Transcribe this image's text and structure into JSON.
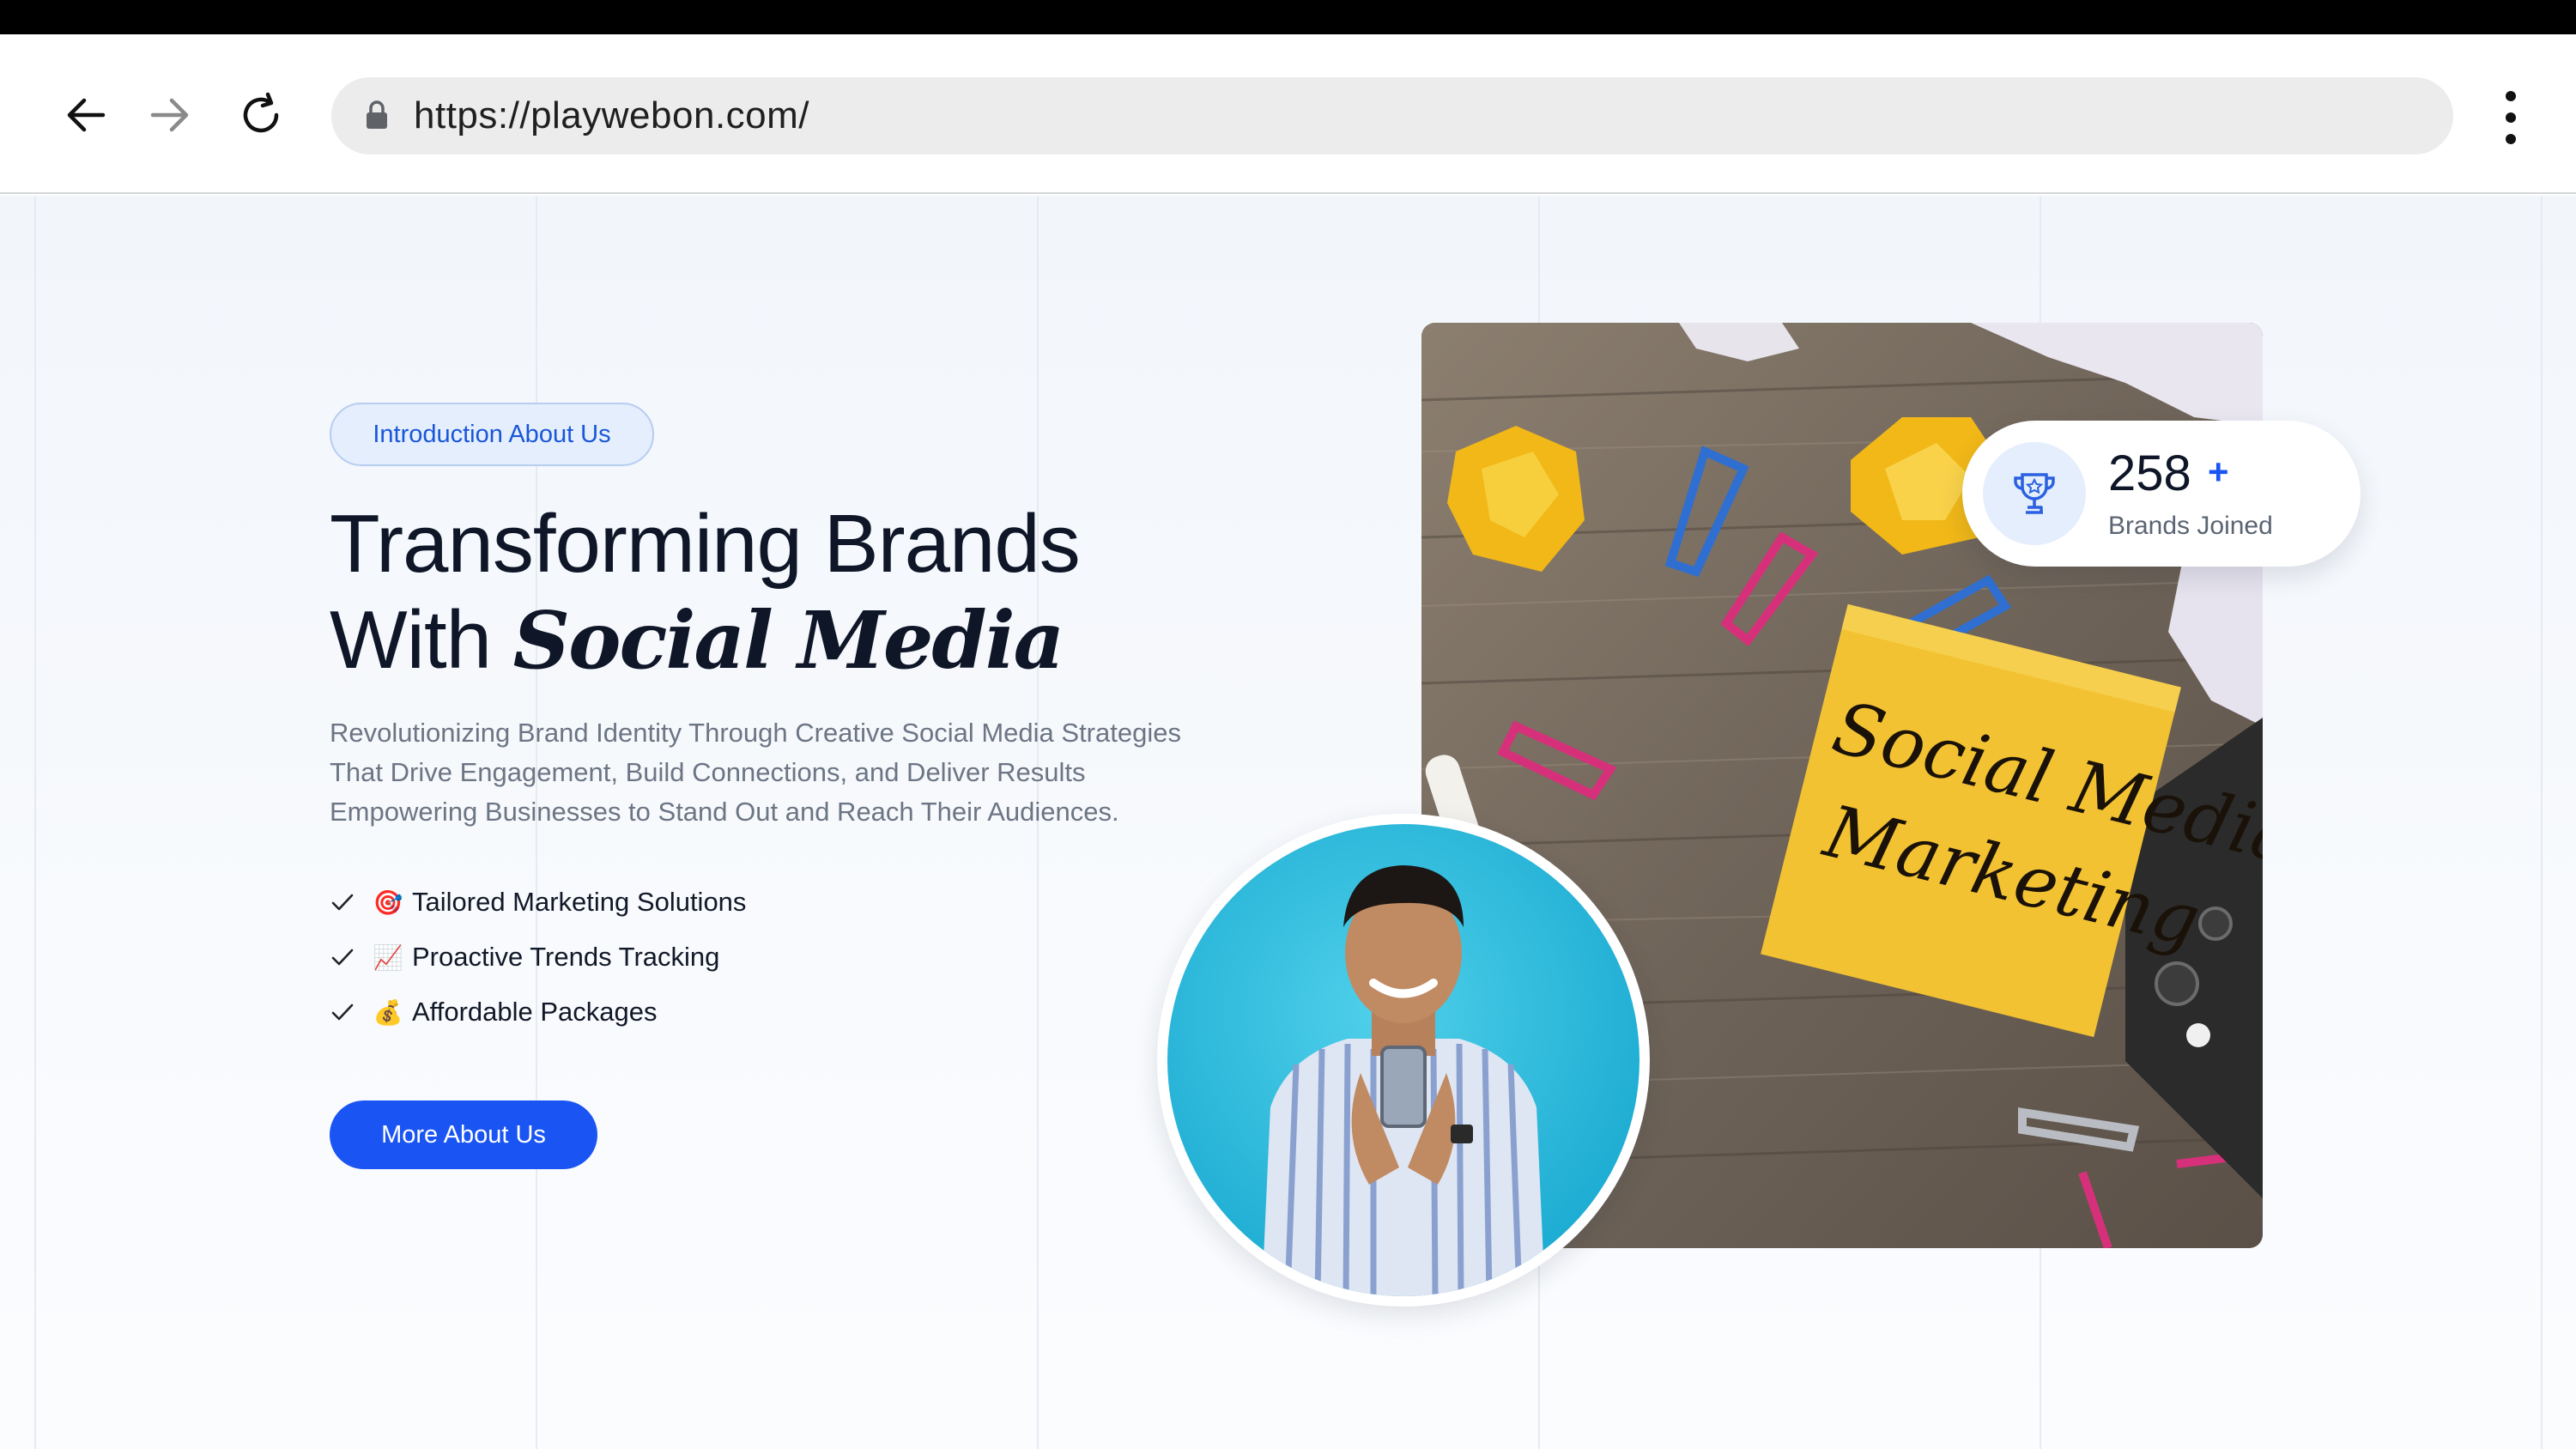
{
  "browser": {
    "url": "https://playwebon.com/",
    "icons": {
      "back": "arrow-left-icon",
      "forward": "arrow-right-icon",
      "reload": "reload-icon",
      "lock": "lock-icon",
      "menu": "kebab-menu-icon"
    }
  },
  "hero": {
    "badge": "Introduction About Us",
    "headline_line1": "Transforming Brands",
    "headline_line2_prefix": "With ",
    "headline_line2_emphasis": "Social Media",
    "description_line1": "Revolutionizing Brand Identity Through Creative Social Media Strategies",
    "description_line2": "That Drive Engagement, Build Connections, and Deliver Results",
    "description_line3": "Empowering Businesses to Stand Out and Reach Their Audiences.",
    "features": [
      {
        "emoji": "🎯",
        "label": "Tailored Marketing Solutions"
      },
      {
        "emoji": "📈",
        "label": "Proactive Trends Tracking"
      },
      {
        "emoji": "💰",
        "label": "Affordable Packages"
      }
    ],
    "cta_label": "More About Us"
  },
  "stats": {
    "number": "258",
    "plus": "+",
    "label": "Brands Joined",
    "icon": "trophy-icon"
  },
  "photo": {
    "note_line1": "Social Media",
    "note_line2": "Marketing"
  },
  "colors": {
    "accent": "#1a55f3",
    "heading": "#0e1628",
    "badge_bg": "#e4eefc",
    "page_bg": "#f2f6fb"
  }
}
